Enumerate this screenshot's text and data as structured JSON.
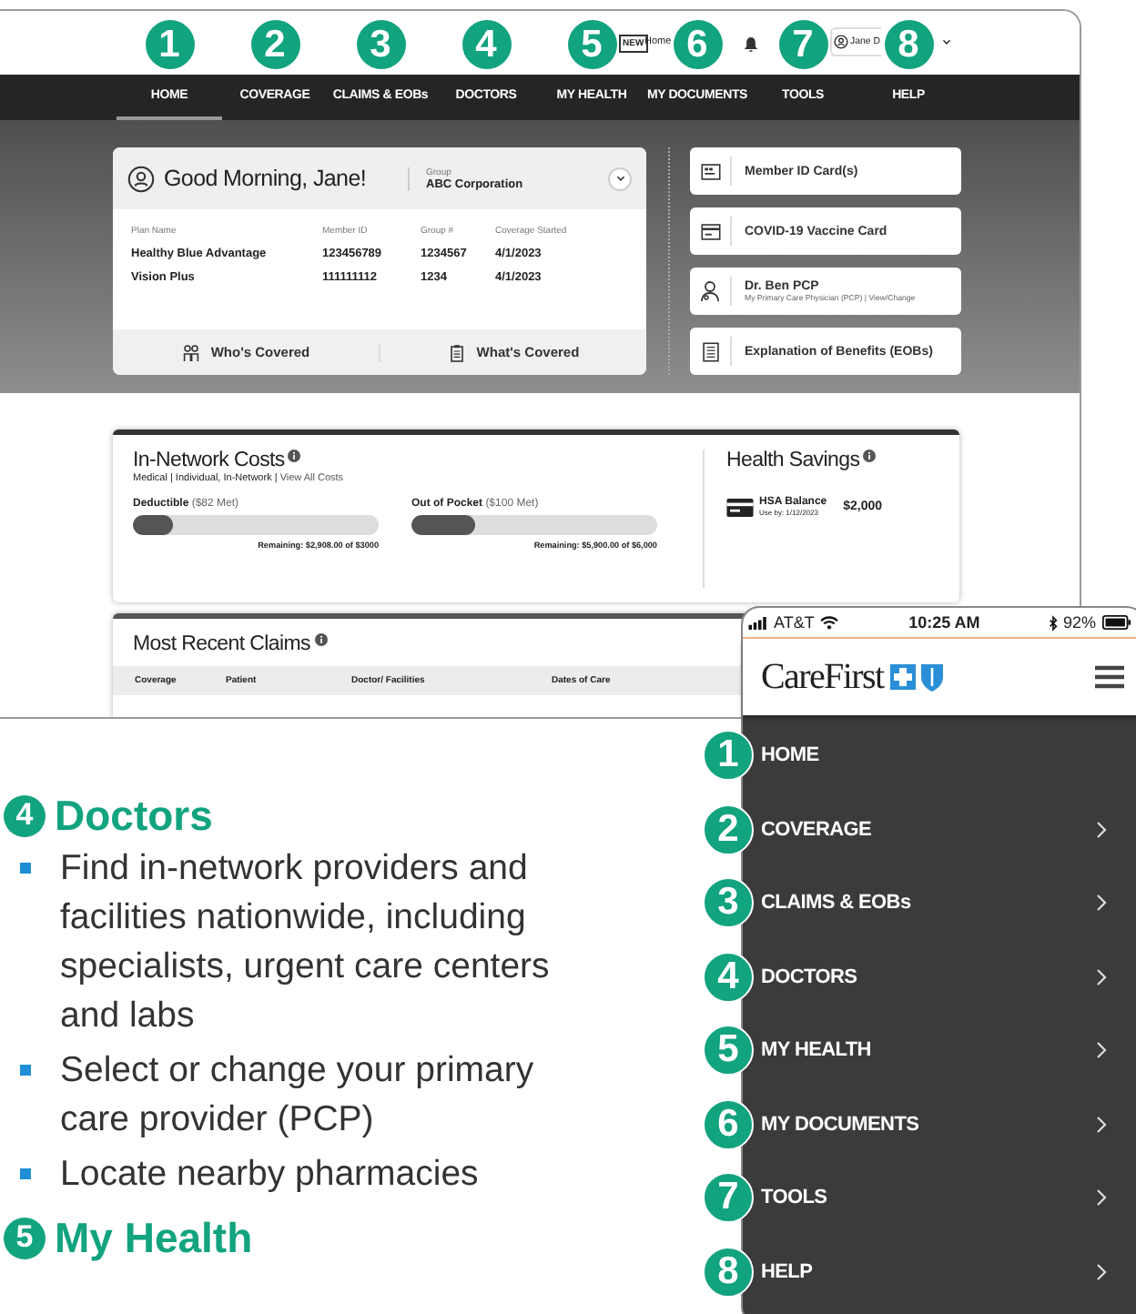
{
  "desktop": {
    "callouts": [
      "1",
      "2",
      "3",
      "4",
      "5",
      "6",
      "7",
      "8"
    ],
    "header": {
      "new_badge": "NEW",
      "home_link": "Home",
      "user_name": "Jane D"
    },
    "nav": [
      {
        "label": "HOME",
        "selected": true
      },
      {
        "label": "COVERAGE",
        "selected": false
      },
      {
        "label": "CLAIMS & EOBs",
        "selected": false
      },
      {
        "label": "DOCTORS",
        "selected": false
      },
      {
        "label": "MY HEALTH",
        "selected": false
      },
      {
        "label": "MY DOCUMENTS",
        "selected": false
      },
      {
        "label": "TOOLS",
        "selected": false
      },
      {
        "label": "HELP",
        "selected": false
      }
    ],
    "member_card": {
      "greeting": "Good Morning, Jane!",
      "group_label": "Group",
      "group_name": "ABC Corporation",
      "columns": [
        "Plan Name",
        "Member ID",
        "Group #",
        "Coverage Started"
      ],
      "rows": [
        [
          "Healthy Blue Advantage",
          "123456789",
          "1234567",
          "4/1/2023"
        ],
        [
          "Vision Plus",
          "111111112",
          "1234",
          "4/1/2023"
        ]
      ],
      "footer_links": [
        {
          "kind": "people",
          "label": "Who's Covered"
        },
        {
          "kind": "clipboard",
          "label": "What's Covered"
        }
      ]
    },
    "quick_links": [
      {
        "kind": "id-card",
        "label": "Member ID Card(s)"
      },
      {
        "kind": "card",
        "label": "COVID-19 Vaccine Card"
      },
      {
        "kind": "doctor",
        "label": "Dr. Ben PCP",
        "sublabel": "My Primary Care Physician (PCP) | View/Change"
      },
      {
        "kind": "document",
        "label": "Explanation of Benefits (EOBs)"
      }
    ],
    "costs": {
      "title": "In-Network Costs",
      "filters": "Medical | Individual, In-Network |",
      "view_all": "View All Costs",
      "meters": [
        {
          "label": "Deductible",
          "met": "($82 Met)",
          "level": 0.16,
          "remaining": "Remaining: $2,908.00 of $3000"
        },
        {
          "label": "Out of Pocket",
          "met": "($100 Met)",
          "level": 0.26,
          "remaining": "Remaining: $5,900.00 of $6,000"
        }
      ]
    },
    "savings": {
      "title": "Health Savings",
      "account": "HSA Balance",
      "use_by": "Use by: 1/12/2023",
      "amount": "$2,000"
    },
    "claims": {
      "title": "Most Recent Claims",
      "columns": [
        "Coverage",
        "Patient",
        "Doctor/ Facilities",
        "Dates of Care"
      ]
    }
  },
  "guide": {
    "sections": [
      {
        "number": "4",
        "title": "Doctors",
        "bullets": [
          "Find in-network providers and facilities nationwide, including specialists, urgent care centers and labs",
          "Select or change your primary care provider (PCP)",
          "Locate nearby pharmacies"
        ]
      },
      {
        "number": "5",
        "title": "My Health"
      }
    ]
  },
  "phone": {
    "carrier": "AT&T",
    "time": "10:25 AM",
    "battery": "92%",
    "brand": "CareFirst",
    "menu": [
      {
        "number": "1",
        "label": "HOME",
        "has_submenu": false
      },
      {
        "number": "2",
        "label": "COVERAGE",
        "has_submenu": true
      },
      {
        "number": "3",
        "label": "CLAIMS & EOBs",
        "has_submenu": true
      },
      {
        "number": "4",
        "label": "DOCTORS",
        "has_submenu": true
      },
      {
        "number": "5",
        "label": "MY HEALTH",
        "has_submenu": true
      },
      {
        "number": "6",
        "label": "MY DOCUMENTS",
        "has_submenu": true
      },
      {
        "number": "7",
        "label": "TOOLS",
        "has_submenu": true
      },
      {
        "number": "8",
        "label": "HELP",
        "has_submenu": true
      }
    ]
  }
}
